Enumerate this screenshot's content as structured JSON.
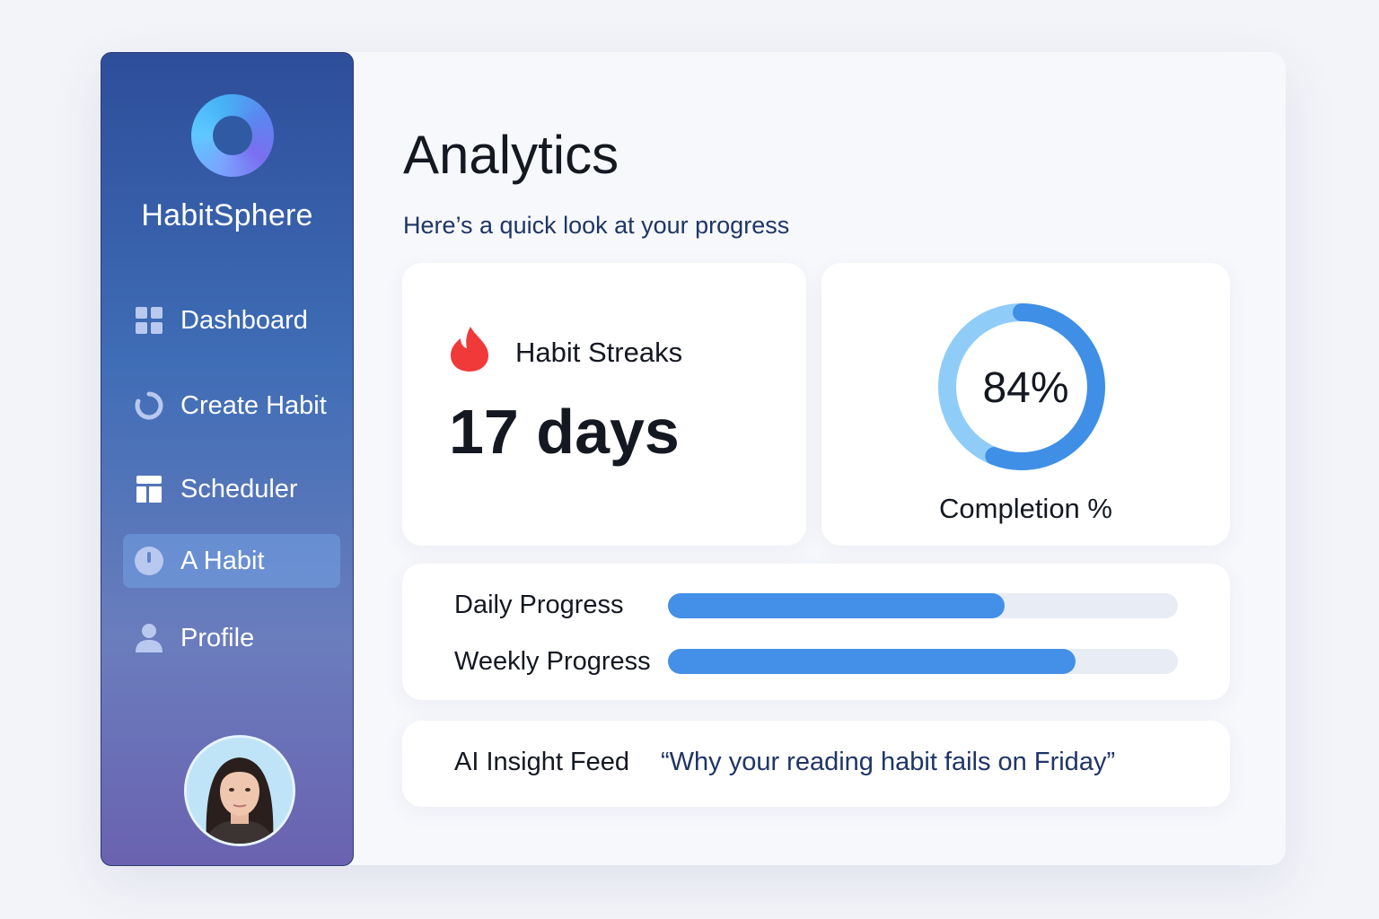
{
  "app": {
    "name": "HabitSphere",
    "logo_icon": "ring-logo-icon"
  },
  "sidebar": {
    "items": [
      {
        "label": "Dashboard",
        "icon": "grid-icon",
        "active": false
      },
      {
        "label": "Create Habit",
        "icon": "circular-arrow-icon",
        "active": false
      },
      {
        "label": "Scheduler",
        "icon": "calendar-icon",
        "active": false
      },
      {
        "label": "A Habit",
        "icon": "clock-icon",
        "active": true
      },
      {
        "label": "Profile",
        "icon": "user-icon",
        "active": false
      }
    ],
    "avatar_icon": "user-avatar"
  },
  "main": {
    "title": "Analytics",
    "subtitle": "Here’s a quick look at your progress"
  },
  "streaks": {
    "label": "Habit Streaks",
    "value": "17 days",
    "icon": "flame-icon",
    "icon_color": "#f03a3a"
  },
  "completion": {
    "value_text": "84%",
    "label": "Completion %",
    "fraction": 0.84,
    "colors": {
      "primary": "#3f8fe6",
      "secondary": "#8fcdf8"
    }
  },
  "progress": {
    "daily": {
      "label": "Daily Progress",
      "fraction": 0.66
    },
    "weekly": {
      "label": "Weekly Progress",
      "fraction": 0.8
    },
    "fill_color": "#4490e8"
  },
  "insight": {
    "label": "AI Insight Feed",
    "text": "“Why your reading habit fails on Friday”"
  }
}
